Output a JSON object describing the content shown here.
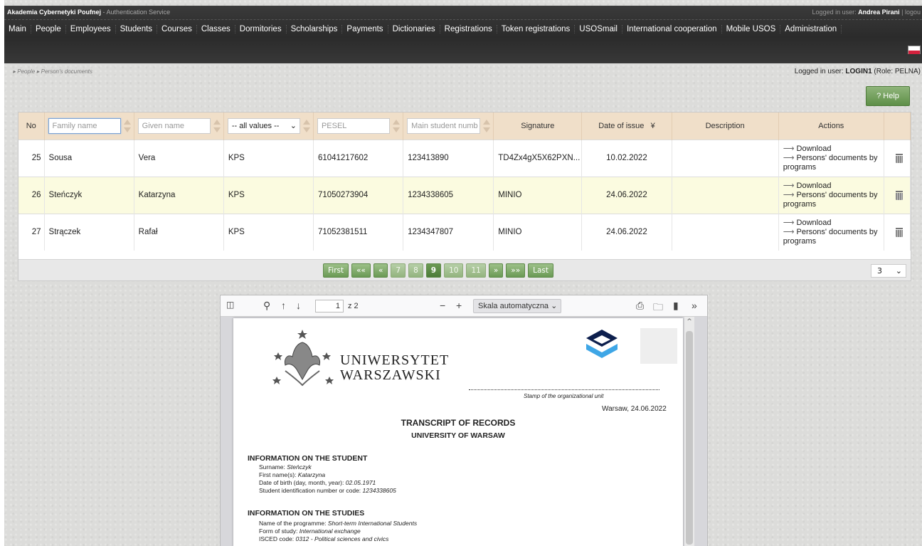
{
  "header": {
    "brand": "Akademia Cybernetyki Poufnej",
    "brand_sub": " - Authentication Service",
    "logged_prefix": "Logged in user: ",
    "logged_name": "Andrea Pirani",
    "logout": " | logou"
  },
  "nav": [
    "Main",
    "People",
    "Employees",
    "Students",
    "Courses",
    "Classes",
    "Dormitories",
    "Scholarships",
    "Payments",
    "Dictionaries",
    "Registrations",
    "Token registrations",
    "USOSmail",
    "International cooperation",
    "Mobile USOS",
    "Administration"
  ],
  "breadcrumb": [
    "People",
    "Person's documents"
  ],
  "logged_info": {
    "prefix": "Logged in user: ",
    "login": "LOGIN1",
    "role": " (Role: PELNA)"
  },
  "help_label": "? Help",
  "table": {
    "headers": {
      "no": "No",
      "signature": "Signature",
      "date": "Date of issue",
      "date_sort": "¥",
      "description": "Description",
      "actions": "Actions"
    },
    "filters": {
      "family": "Family name",
      "given": "Given name",
      "type": "-- all values --",
      "pesel": "PESEL",
      "student": "Main student numb"
    },
    "rows": [
      {
        "no": "25",
        "family": "Sousa",
        "given": "Vera",
        "type": "KPS",
        "pesel": "61041217602",
        "student": "123413890",
        "signature": "TD4Zx4gX5X62PXN...",
        "date": "10.02.2022",
        "description": "",
        "download": "Download",
        "docs": "Persons' documents by programs"
      },
      {
        "no": "26",
        "family": "Stеńczyk",
        "given": "Katarzyna",
        "type": "KPS",
        "pesel": "71050273904",
        "student": "1234338605",
        "signature": "MINIO",
        "date": "24.06.2022",
        "description": "",
        "download": "Download",
        "docs": "Persons' documents by programs"
      },
      {
        "no": "27",
        "family": "Strączek",
        "given": "Rafał",
        "type": "KPS",
        "pesel": "71052381511",
        "student": "1234347807",
        "signature": "MINIO",
        "date": "24.06.2022",
        "description": "",
        "download": "Download",
        "docs": "Persons' documents by programs"
      }
    ],
    "arrow_glyph": "⟶"
  },
  "pager": {
    "first": "First",
    "prevprev": "««",
    "prev": "«",
    "pages": [
      "7",
      "8",
      "9",
      "10",
      "11"
    ],
    "current": "9",
    "next": "»",
    "nextnext": "»»",
    "last": "Last",
    "page_size": "3"
  },
  "pdf": {
    "page_number": "1",
    "of_pages": "z 2",
    "zoom": "Skala automatyczna",
    "university_line1": "UNIWERSYTET",
    "university_line2": "WARSZAWSKI",
    "stamp_label": "Stamp of the organizational unit",
    "place_date": "Warsaw, 24.06.2022",
    "title": "TRANSCRIPT OF RECORDS",
    "subtitle": "UNIVERSITY OF WARSAW",
    "section1": "INFORMATION ON THE STUDENT",
    "student_fields": [
      {
        "label": "Surname: ",
        "value": "Steńczyk"
      },
      {
        "label": "First name(s): ",
        "value": "Katarzyna"
      },
      {
        "label": "Date of birth (day, month, year): ",
        "value": "02.05.1971"
      },
      {
        "label": "Student identification number or code: ",
        "value": "1234338605"
      }
    ],
    "section2": "INFORMATION ON THE STUDIES",
    "study_fields": [
      {
        "label": "Name of the programme: ",
        "value": "Short-term International Students"
      },
      {
        "label": "Form of study: ",
        "value": "International exchange"
      },
      {
        "label": "ISCED code: ",
        "value": "0312 - Political sciences and civics"
      }
    ]
  },
  "colors": {
    "accent_green": "#6b9a55",
    "header_bg": "#2b2b2b",
    "table_header": "#f0dfc9",
    "highlight_row": "#fbfbe0"
  }
}
